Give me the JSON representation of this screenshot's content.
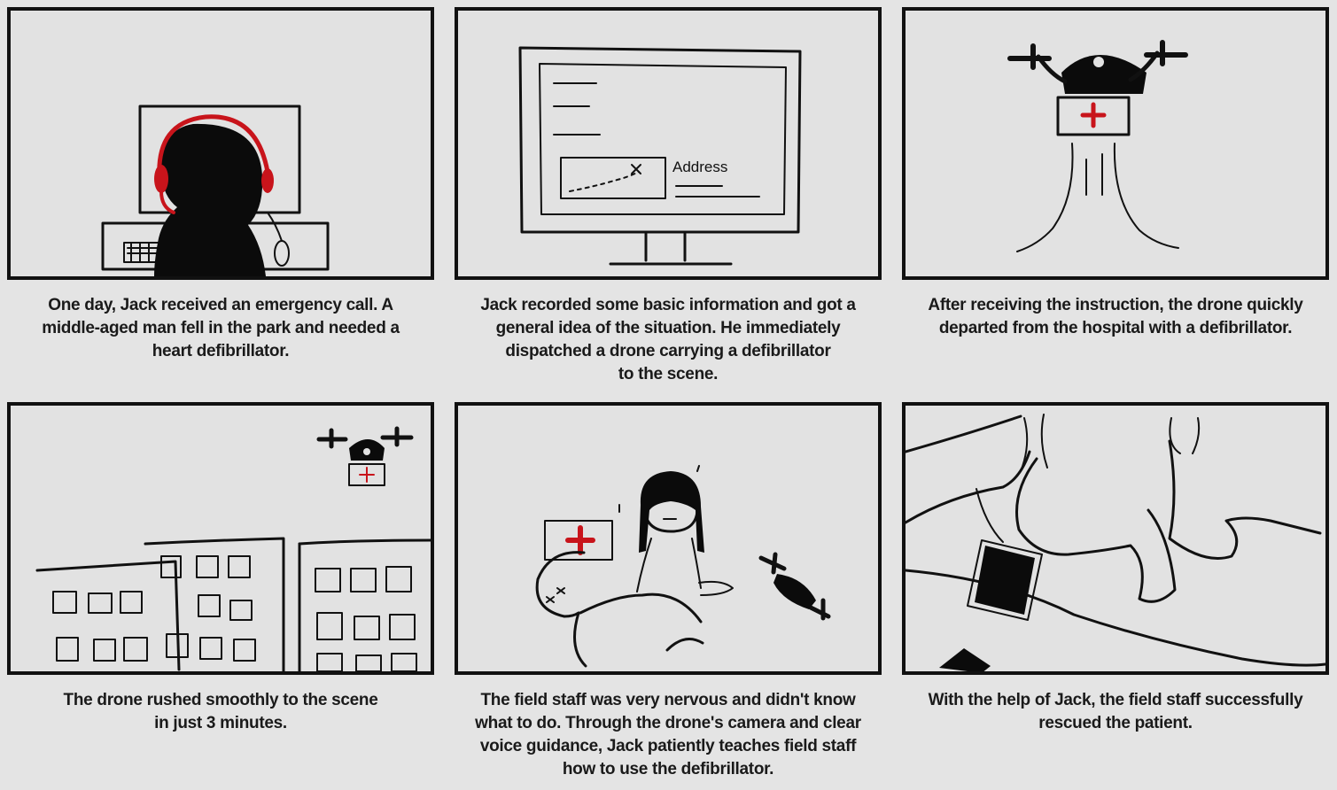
{
  "panels": [
    {
      "scene": "operator-at-computer",
      "caption_lines": [
        "One day, Jack received an emergency call. A",
        "middle-aged man fell in the park and needed a",
        "heart defibrillator."
      ]
    },
    {
      "scene": "monitor-with-map",
      "screen_label": "Address",
      "caption_lines": [
        "Jack recorded some basic information and got a",
        "general idea of the situation. He immediately",
        "dispatched a drone carrying a defibrillator",
        "to the scene."
      ]
    },
    {
      "scene": "drone-takeoff",
      "caption_lines": [
        "After receiving the instruction, the drone quickly",
        "departed from the hospital with a defibrillator."
      ]
    },
    {
      "scene": "drone-over-buildings",
      "caption_lines": [
        "The drone rushed smoothly to the scene",
        "in just 3 minutes."
      ]
    },
    {
      "scene": "field-staff-with-patient",
      "caption_lines": [
        "The field staff was very nervous and didn't know",
        "what to do. Through the drone's camera and clear",
        "voice guidance, Jack patiently teaches field staff",
        "how to use the defibrillator."
      ]
    },
    {
      "scene": "using-defibrillator",
      "caption_lines": [
        "With the help of Jack, the field staff successfully",
        "rescued the patient."
      ]
    }
  ],
  "colors": {
    "ink": "#111111",
    "accent_red": "#c8141b",
    "paper": "#e2e2e2"
  }
}
